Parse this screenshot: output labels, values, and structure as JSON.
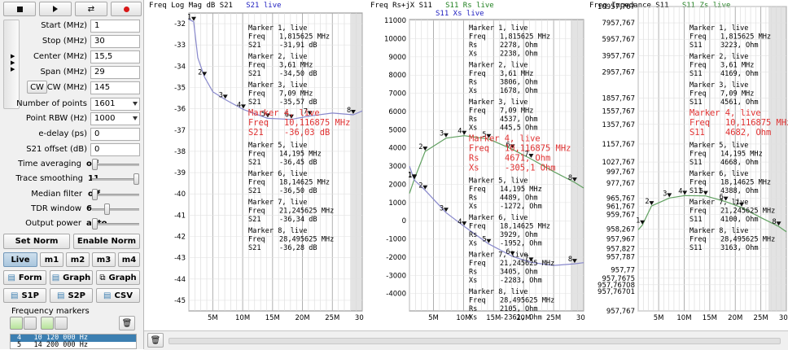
{
  "toolbar": {
    "stop_icon": "stop-icon",
    "play_icon": "play-icon",
    "toggle_icon": "swap-icon",
    "record_icon": "record-icon"
  },
  "freq": {
    "start_label": "Start (MHz)",
    "start_value": "1",
    "stop_label": "Stop (MHz)",
    "stop_value": "30",
    "center_label": "Center (MHz)",
    "center_value": "15,5",
    "span_label": "Span (MHz)",
    "span_value": "29",
    "cw_button": "CW",
    "cw_label": "CW (MHz)",
    "cw_value": "145",
    "points_label": "Number of points",
    "points_value": "1601",
    "rbw_label": "Point RBW (Hz)",
    "rbw_value": "1000",
    "edelay_label": "e-delay (ps)",
    "edelay_value": "0",
    "offset_label": "S21 offset (dB)",
    "offset_value": "0"
  },
  "settings": {
    "time_avg_label": "Time averaging",
    "time_avg_value": "off",
    "time_avg_level": 0,
    "smoothing_label": "Trace smoothing",
    "smoothing_value": "11",
    "smoothing_level": 1,
    "median_label": "Median filter",
    "median_value": "off",
    "median_level": 0,
    "tdr_label": "TDR window",
    "tdr_value": "6",
    "tdr_level": 0.3,
    "power_label": "Output power",
    "power_value": "auto",
    "power_level": 0
  },
  "norm": {
    "set_label": "Set Norm",
    "enable_label": "Enable Norm"
  },
  "modes": {
    "live": "Live",
    "m1": "m1",
    "m2": "m2",
    "m3": "m3",
    "m4": "m4"
  },
  "actions": {
    "form": "Form",
    "graph1": "Graph",
    "graph2": "Graph",
    "s1p": "S1P",
    "s2p": "S2P",
    "csv": "CSV"
  },
  "markers_panel": {
    "title": "Frequency markers",
    "trash_icon": "trash-icon",
    "list": [
      {
        "index": "4",
        "freq": "10 120 000 Hz"
      },
      {
        "index": "5",
        "freq": "14 200 000 Hz"
      }
    ]
  },
  "accent": "#3c7fb1",
  "chart_data": [
    {
      "type": "line",
      "title": "Freq Log Mag dB S21",
      "legend": "S21 live",
      "legend_color": "#2020c0",
      "xlim": [
        1,
        30
      ],
      "ylim": [
        -45.5,
        -31.5
      ],
      "x_ticks": [
        5,
        10,
        15,
        20,
        25,
        30
      ],
      "x_tick_labels": [
        "5M",
        "10M",
        "15M",
        "20M",
        "25M",
        "30M"
      ],
      "y_ticks": [
        "-32",
        "-33",
        "-34",
        "-35",
        "-36",
        "-37",
        "-38",
        "-39",
        "-40",
        "-41",
        "-42",
        "-43",
        "-44",
        "-45"
      ],
      "series": [
        {
          "name": "S21 live",
          "color": "#8888cc",
          "x": [
            1,
            1.8,
            2.5,
            3.6,
            5,
            7.1,
            10.1,
            14.2,
            18.1,
            21.2,
            25,
            28.5,
            30
          ],
          "y": [
            -31.8,
            -31.91,
            -33.6,
            -34.5,
            -35.2,
            -35.57,
            -36.03,
            -36.45,
            -36.5,
            -36.34,
            -36.2,
            -36.28,
            -36.1
          ]
        }
      ],
      "markers": [
        {
          "id": "1",
          "x": 1.815625,
          "y": -31.91
        },
        {
          "id": "2",
          "x": 3.61,
          "y": -34.5
        },
        {
          "id": "3",
          "x": 7.09,
          "y": -35.57
        },
        {
          "id": "4",
          "x": 10.116875,
          "y": -36.03
        },
        {
          "id": "5",
          "x": 14.195,
          "y": -36.45
        },
        {
          "id": "6",
          "x": 18.14625,
          "y": -36.5
        },
        {
          "id": "7",
          "x": 21.245625,
          "y": -36.34
        },
        {
          "id": "8",
          "x": 28.495625,
          "y": -36.28
        }
      ],
      "marker_readouts": [
        {
          "title": "Marker 1, live",
          "lines": [
            [
              "Freq",
              "1,815625 MHz"
            ],
            [
              "S21",
              "-31,91 dB"
            ]
          ]
        },
        {
          "title": "Marker 2, live",
          "lines": [
            [
              "Freq",
              "3,61 MHz"
            ],
            [
              "S21",
              "-34,50 dB"
            ]
          ]
        },
        {
          "title": "Marker 3, live",
          "lines": [
            [
              "Freq",
              "7,09 MHz"
            ],
            [
              "S21",
              "-35,57 dB"
            ]
          ]
        },
        {
          "title": "Marker 4, live",
          "highlight": true,
          "lines": [
            [
              "Freq",
              "10,116875 MHz"
            ],
            [
              "S21",
              "-36,03 dB"
            ]
          ]
        },
        {
          "title": "Marker 5, live",
          "lines": [
            [
              "Freq",
              "14,195 MHz"
            ],
            [
              "S21",
              "-36,45 dB"
            ]
          ]
        },
        {
          "title": "Marker 6, live",
          "lines": [
            [
              "Freq",
              "18,14625 MHz"
            ],
            [
              "S21",
              "-36,50 dB"
            ]
          ]
        },
        {
          "title": "Marker 7, live",
          "lines": [
            [
              "Freq",
              "21,245625 MHz"
            ],
            [
              "S21",
              "-36,34 dB"
            ]
          ]
        },
        {
          "title": "Marker 8, live",
          "lines": [
            [
              "Freq",
              "28,495625 MHz"
            ],
            [
              "S21",
              "-36,28 dB"
            ]
          ]
        }
      ]
    },
    {
      "type": "line",
      "title": "Freq Rs+jX S11",
      "legend": "S11 Rs live",
      "legend2": "S11 Xs live",
      "legend_color": "#208020",
      "legend2_color": "#2020c0",
      "xlim": [
        1,
        30
      ],
      "ylim": [
        -4950,
        11050
      ],
      "x_ticks": [
        5,
        10,
        15,
        20,
        25,
        30
      ],
      "x_tick_labels": [
        "5M",
        "10M",
        "15M",
        "20M",
        "25M",
        "30M"
      ],
      "y_ticks": [
        "11000",
        "10000",
        "9000",
        "8000",
        "7000",
        "6000",
        "5000",
        "4000",
        "3000",
        "2000",
        "1000",
        "0",
        "-1000",
        "-2000",
        "-3000",
        "-4000"
      ],
      "series": [
        {
          "name": "S11 Rs live",
          "color": "#60a060",
          "x": [
            1,
            1.8,
            3.6,
            7.1,
            10.1,
            14.2,
            18.1,
            21.2,
            25,
            28.5,
            30
          ],
          "y": [
            1500,
            2278,
            3806,
            4537,
            4671,
            4489,
            3929,
            3405,
            2700,
            2105,
            1800
          ]
        },
        {
          "name": "S11 Xs live",
          "color": "#8888cc",
          "x": [
            1,
            1.8,
            3.6,
            7.1,
            10.1,
            14.2,
            18.1,
            21.2,
            25,
            28.5,
            30
          ],
          "y": [
            3000,
            2238,
            1678,
            445.5,
            -305.1,
            -1272,
            -1952,
            -2283,
            -2450,
            -2361,
            -2300
          ]
        }
      ],
      "markers": [
        {
          "id": "1",
          "x": 1.815625,
          "y": 2278
        },
        {
          "id": "2",
          "x": 3.61,
          "y": 3806
        },
        {
          "id": "3",
          "x": 7.09,
          "y": 4537
        },
        {
          "id": "4",
          "x": 10.116875,
          "y": 4671
        },
        {
          "id": "5",
          "x": 14.195,
          "y": 4489
        },
        {
          "id": "6",
          "x": 18.14625,
          "y": 3929
        },
        {
          "id": "7",
          "x": 21.245625,
          "y": 3405
        },
        {
          "id": "8",
          "x": 28.495625,
          "y": 2105
        },
        {
          "id": "1",
          "x": 1.815625,
          "y": 2238
        },
        {
          "id": "2",
          "x": 3.61,
          "y": 1678
        },
        {
          "id": "3",
          "x": 7.09,
          "y": 445.5
        },
        {
          "id": "4",
          "x": 10.116875,
          "y": -305.1
        },
        {
          "id": "5",
          "x": 14.195,
          "y": -1272
        },
        {
          "id": "6",
          "x": 18.14625,
          "y": -1952
        },
        {
          "id": "7",
          "x": 21.245625,
          "y": -2283
        },
        {
          "id": "8",
          "x": 28.495625,
          "y": -2361
        }
      ],
      "marker_readouts": [
        {
          "title": "Marker 1, live",
          "lines": [
            [
              "Freq",
              "1,815625 MHz"
            ],
            [
              "Rs",
              "2278, Ohm"
            ],
            [
              "Xs",
              "2238, Ohm"
            ]
          ]
        },
        {
          "title": "Marker 2, live",
          "lines": [
            [
              "Freq",
              "3,61 MHz"
            ],
            [
              "Rs",
              "3806, Ohm"
            ],
            [
              "Xs",
              "1678, Ohm"
            ]
          ]
        },
        {
          "title": "Marker 3, live",
          "lines": [
            [
              "Freq",
              "7,09 MHz"
            ],
            [
              "Rs",
              "4537, Ohm"
            ],
            [
              "Xs",
              "445,5 Ohm"
            ]
          ]
        },
        {
          "title": "Marker 4, live",
          "highlight": true,
          "lines": [
            [
              "Freq",
              "10,116875 MHz"
            ],
            [
              "Rs",
              "4671, Ohm"
            ],
            [
              "Xs",
              "-305,1 Ohm"
            ]
          ]
        },
        {
          "title": "Marker 5, live",
          "lines": [
            [
              "Freq",
              "14,195 MHz"
            ],
            [
              "Rs",
              "4489, Ohm"
            ],
            [
              "Xs",
              "-1272, Ohm"
            ]
          ]
        },
        {
          "title": "Marker 6, live",
          "lines": [
            [
              "Freq",
              "18,14625 MHz"
            ],
            [
              "Rs",
              "3929, Ohm"
            ],
            [
              "Xs",
              "-1952, Ohm"
            ]
          ]
        },
        {
          "title": "Marker 7, live",
          "lines": [
            [
              "Freq",
              "21,245625 MHz"
            ],
            [
              "Rs",
              "3405, Ohm"
            ],
            [
              "Xs",
              "-2283, Ohm"
            ]
          ]
        },
        {
          "title": "Marker 8, live",
          "lines": [
            [
              "Freq",
              "28,495625 MHz"
            ],
            [
              "Rs",
              "2105, Ohm"
            ],
            [
              "Xs",
              "-2361, Ohm"
            ]
          ]
        }
      ]
    },
    {
      "type": "line",
      "title": "Freq Impedance S11",
      "legend": "S11 Zs live",
      "legend_color": "#208020",
      "xlim": [
        1,
        30
      ],
      "ylim": [
        -1,
        14
      ],
      "x_ticks": [
        5,
        10,
        15,
        20,
        25,
        30
      ],
      "x_tick_labels": [
        "5M",
        "10M",
        "15M",
        "20M",
        "25M",
        "30M"
      ],
      "y_ticks": [
        "10957,767",
        "7957,767",
        "5957,767",
        "3957,767",
        "2957,767",
        "1857,767",
        "1557,767",
        "1357,767",
        "1157,767",
        "1027,767",
        "997,767",
        "977,767",
        "965,767",
        "961,767",
        "959,767",
        "958,267",
        "957,967",
        "957,827",
        "957,787",
        "957,77",
        "957,7675",
        "957,76708",
        "957,76701",
        "957,767"
      ],
      "y_tick_rows": [
        0,
        1,
        2,
        3,
        4,
        5.6,
        6.4,
        7.2,
        8.4,
        9.5,
        10.1,
        10.8,
        11.7,
        12.2,
        12.7,
        13.6,
        14.2,
        14.8,
        15.3,
        16.1,
        16.6,
        17.0,
        17.4,
        18.6
      ],
      "series": [
        {
          "name": "S11 Zs live",
          "color": "#60a060",
          "x": [
            1,
            1.8,
            3.6,
            7.1,
            10.1,
            14.2,
            18.1,
            21.2,
            25,
            28.5,
            30
          ],
          "y": [
            3.0,
            3.223,
            4.169,
            4.561,
            4.682,
            4.668,
            4.388,
            4.1,
            3.6,
            3.163,
            2.9
          ]
        }
      ],
      "markers": [
        {
          "id": "1",
          "x": 1.815625,
          "y": 3.223
        },
        {
          "id": "2",
          "x": 3.61,
          "y": 4.169
        },
        {
          "id": "3",
          "x": 7.09,
          "y": 4.561
        },
        {
          "id": "4",
          "x": 10.116875,
          "y": 4.682
        },
        {
          "id": "5",
          "x": 14.195,
          "y": 4.668
        },
        {
          "id": "6",
          "x": 18.14625,
          "y": 4.388
        },
        {
          "id": "7",
          "x": 21.245625,
          "y": 4.1
        },
        {
          "id": "8",
          "x": 28.495625,
          "y": 3.163
        }
      ],
      "marker_readouts": [
        {
          "title": "Marker 1, live",
          "lines": [
            [
              "Freq",
              "1,815625 MHz"
            ],
            [
              "S11",
              "3223, Ohm"
            ]
          ]
        },
        {
          "title": "Marker 2, live",
          "lines": [
            [
              "Freq",
              "3,61 MHz"
            ],
            [
              "S11",
              "4169, Ohm"
            ]
          ]
        },
        {
          "title": "Marker 3, live",
          "lines": [
            [
              "Freq",
              "7,09 MHz"
            ],
            [
              "S11",
              "4561, Ohm"
            ]
          ]
        },
        {
          "title": "Marker 4, live",
          "highlight": true,
          "lines": [
            [
              "Freq",
              "10,116875 MHz"
            ],
            [
              "S11",
              "4682, Ohm"
            ]
          ]
        },
        {
          "title": "Marker 5, live",
          "lines": [
            [
              "Freq",
              "14,195 MHz"
            ],
            [
              "S11",
              "4668, Ohm"
            ]
          ]
        },
        {
          "title": "Marker 6, live",
          "lines": [
            [
              "Freq",
              "18,14625 MHz"
            ],
            [
              "S11",
              "4388, Ohm"
            ]
          ]
        },
        {
          "title": "Marker 7, live",
          "lines": [
            [
              "Freq",
              "21,245625 MHz"
            ],
            [
              "S11",
              "4100, Ohm"
            ]
          ]
        },
        {
          "title": "Marker 8, live",
          "lines": [
            [
              "Freq",
              "28,495625 MHz"
            ],
            [
              "S11",
              "3163, Ohm"
            ]
          ]
        }
      ]
    }
  ]
}
